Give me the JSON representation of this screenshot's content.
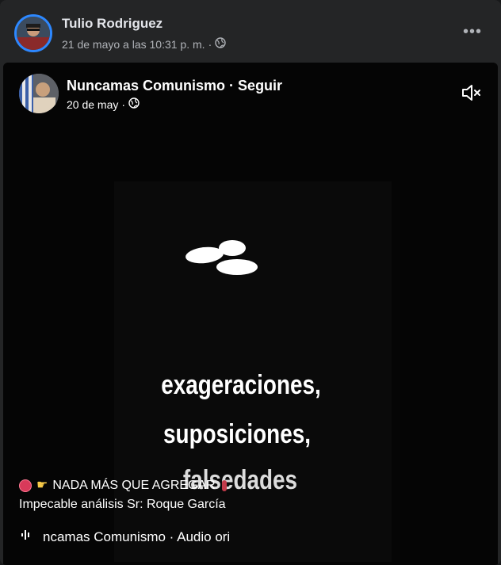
{
  "outer_post": {
    "author": "Tulio Rodriguez",
    "timestamp": "21 de mayo a las 10:31 p. m.",
    "separator": "·",
    "more_label": "•••"
  },
  "inner_post": {
    "author": "Nuncamas Comunismo",
    "separator": " · ",
    "follow_label": "Seguir",
    "date": "20 de may",
    "date_separator": "·"
  },
  "video": {
    "overlay_lines": [
      "exageraciones,",
      "suposiciones,",
      "falsedades"
    ],
    "caption_line1": "NADA MÁS QUE AGREGAR",
    "caption_line2": "Impecable análisis Sr: Roque García",
    "audio_text": "ncamas Comunismo · Audio ori"
  },
  "colors": {
    "card_bg": "#242526",
    "accent_ring": "#2d88ff",
    "secondary_text": "#b0b3b8"
  }
}
